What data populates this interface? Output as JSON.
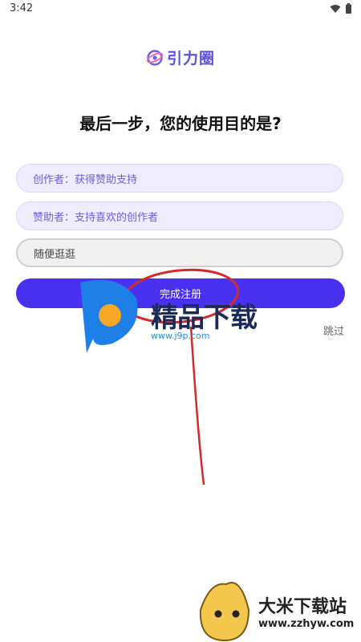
{
  "status_bar": {
    "time": "3:42",
    "icons": [
      "wifi-icon",
      "battery-icon"
    ]
  },
  "app": {
    "name": "引力圈",
    "logo_icon": "orbit-logo-icon",
    "brand_color": "#5b4fe0"
  },
  "page": {
    "headline": "最后一步，您的使用目的是?"
  },
  "options": [
    {
      "label": "创作者：获得赞助支持",
      "style": "purple"
    },
    {
      "label": "赞助者：支持喜欢的创作者",
      "style": "purple"
    },
    {
      "label": "随便逛逛",
      "style": "gray"
    }
  ],
  "actions": {
    "submit_label": "完成注册",
    "submit_color": "#4a31f0",
    "skip_label": "跳过"
  },
  "watermarks": {
    "jp_title": "精品下载",
    "jp_url": "www.j9p.com",
    "dm_title": "大米下载站",
    "dm_url": "www.zzhyw.com"
  },
  "annotation": {
    "type": "red-ellipse-with-arrow",
    "color": "#d42a2a"
  }
}
